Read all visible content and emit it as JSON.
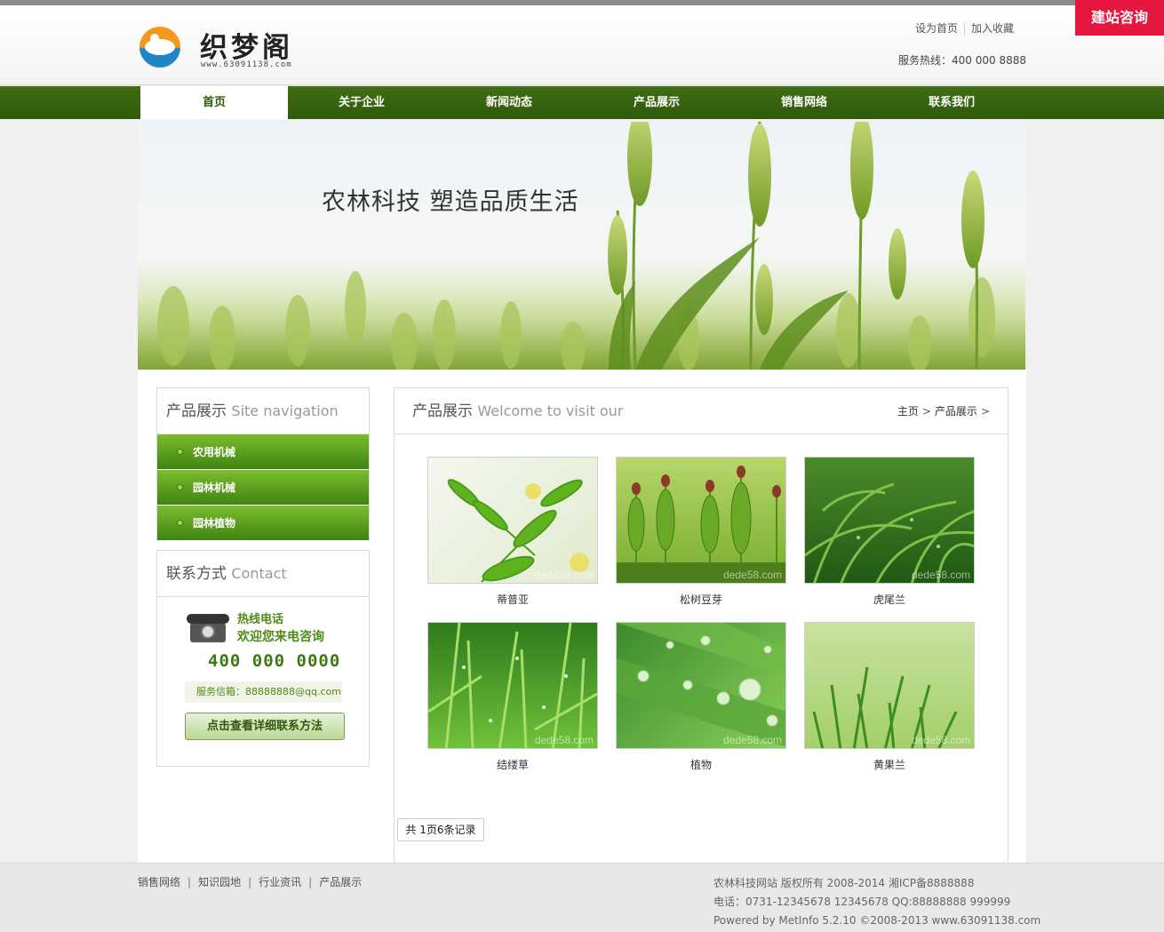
{
  "header": {
    "logo_title": "织梦阁",
    "logo_subtitle": "www.63091138.com",
    "set_home": "设为首页",
    "add_favorite": "加入收藏",
    "hotline": "服务热线：400 000 8888",
    "consult_button": "建站咨询"
  },
  "nav": {
    "items": [
      {
        "label": "首页"
      },
      {
        "label": "关于企业"
      },
      {
        "label": "新闻动态"
      },
      {
        "label": "产品展示"
      },
      {
        "label": "销售网络"
      },
      {
        "label": "联系我们"
      }
    ],
    "active_index": 0
  },
  "banner": {
    "slogan": "农林科技  塑造品质生活"
  },
  "sidebar": {
    "nav_title": "产品展示",
    "nav_title_en": "Site navigation",
    "menu": [
      {
        "label": "农用机械"
      },
      {
        "label": "园林机械"
      },
      {
        "label": "园林植物"
      }
    ],
    "contact_title": "联系方式",
    "contact_title_en": "Contact",
    "hotline_label": "热线电话",
    "hotline_sub": "欢迎您来电咨询",
    "hotline_number": "400 000 0000",
    "email": "服务信箱：88888888@qq.com",
    "detail_button": "点击查看详细联系方法"
  },
  "content": {
    "title": "产品展示",
    "title_en": "Welcome to visit our",
    "breadcrumb": [
      {
        "label": "主页"
      },
      {
        "label": "产品展示"
      }
    ],
    "products": [
      {
        "name": "蒂普亚",
        "watermark": "dede58.com"
      },
      {
        "name": "松树豆芽",
        "watermark": "dede58.com"
      },
      {
        "name": "虎尾兰",
        "watermark": "dede58.com"
      },
      {
        "name": "结缕草",
        "watermark": "dede58.com"
      },
      {
        "name": "植物",
        "watermark": "dede58.com"
      },
      {
        "name": "黄果兰",
        "watermark": "dede58.com"
      }
    ],
    "pager": "共 1页6条记录"
  },
  "footer": {
    "links": [
      {
        "label": "销售网络"
      },
      {
        "label": "知识园地"
      },
      {
        "label": "行业资讯"
      },
      {
        "label": "产品展示"
      }
    ],
    "copyright": "农林科技网站 版权所有 2008-2014 湘ICP备8888888",
    "contact": "电话：0731-12345678 12345678 QQ:88888888 999999",
    "powered": "Powered by MetInfo 5.2.10 ©2008-2013 www.63091138.com"
  },
  "colors": {
    "nav_green": "#2f5a0b",
    "accent_green": "#4f8a18",
    "consult_red": "#e6173e"
  }
}
